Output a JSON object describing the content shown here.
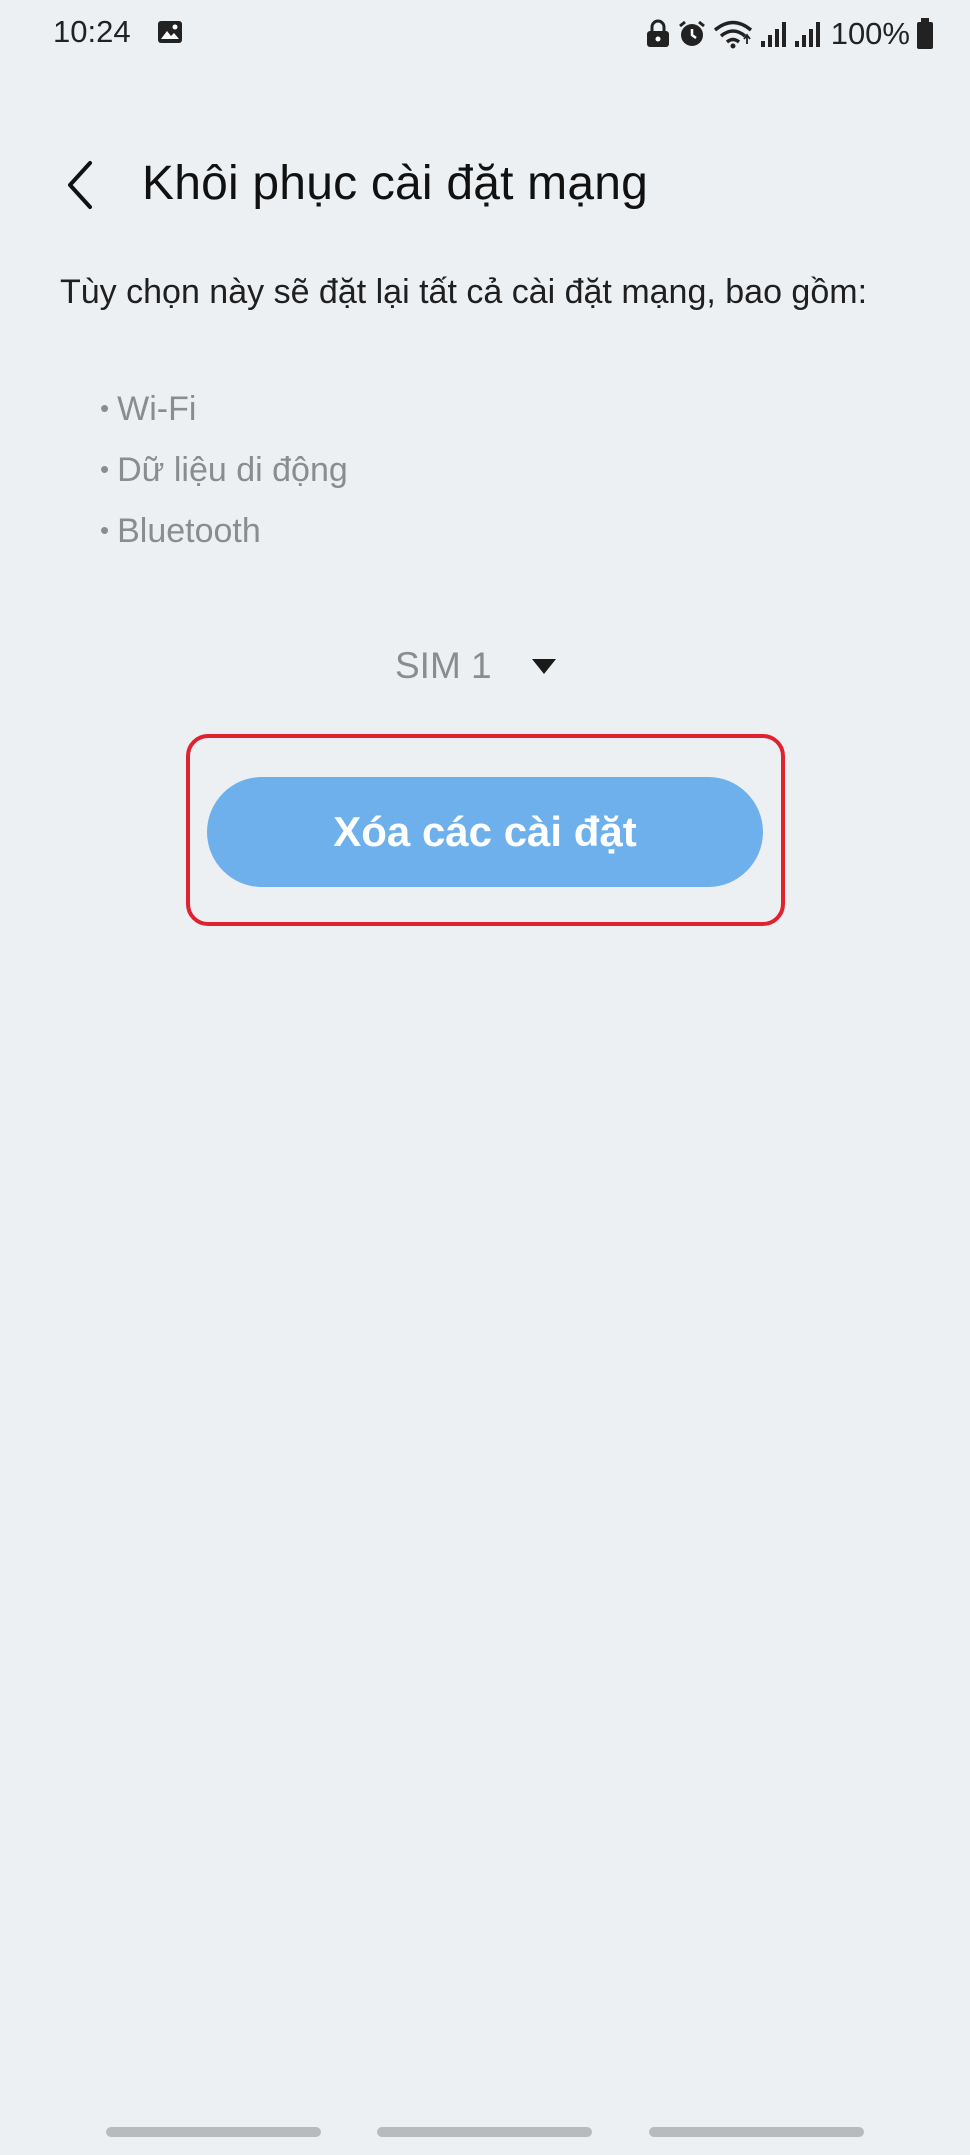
{
  "status_bar": {
    "time": "10:24",
    "battery_text": "100%",
    "icons": [
      "gallery-icon",
      "lock-icon",
      "alarm-icon",
      "wifi-icon",
      "signal-icon",
      "signal-icon",
      "battery-icon"
    ]
  },
  "header": {
    "back_icon": "chevron-left-icon",
    "title": "Khôi phục cài đặt mạng"
  },
  "description": "Tùy chọn này sẽ đặt lại tất cả cài đặt mạng, bao gồm:",
  "bullets": [
    {
      "label": "Wi-Fi"
    },
    {
      "label": "Dữ liệu di động"
    },
    {
      "label": "Bluetooth"
    }
  ],
  "sim_selector": {
    "selected": "SIM 1",
    "icon": "dropdown-arrow-icon"
  },
  "reset_button": {
    "label": "Xóa các cài đặt"
  },
  "colors": {
    "background": "#edf0f3",
    "button": "#6db0ec",
    "highlight": "#e0212e",
    "muted_text": "#8a8c8f"
  }
}
